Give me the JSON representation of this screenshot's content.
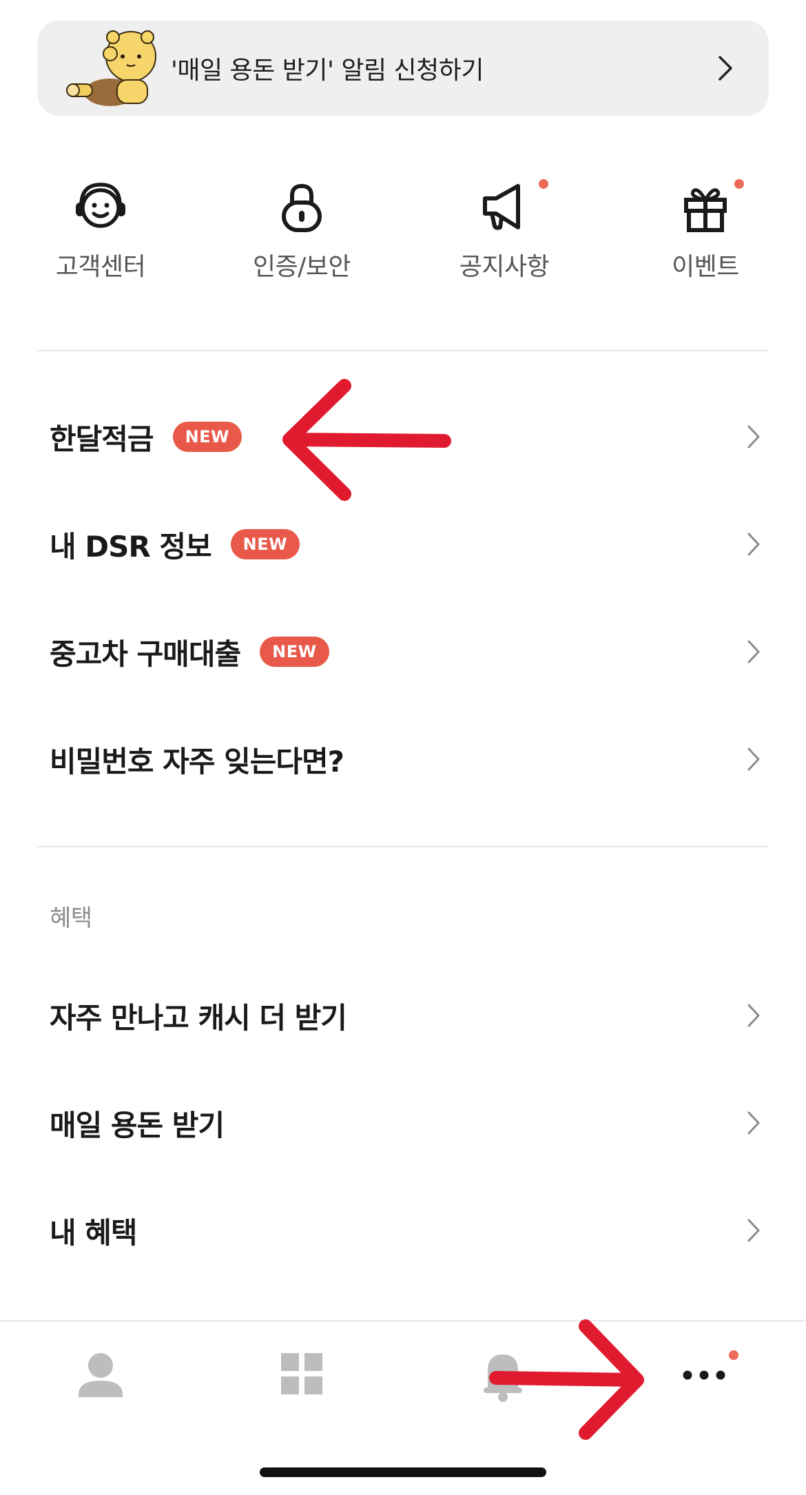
{
  "banner": {
    "text": "'매일 용돈 받기' 알림 신청하기",
    "icon": "chevron-right-icon"
  },
  "quick_menu": [
    {
      "label": "고객센터",
      "icon": "headset-smile-icon",
      "has_dot": false
    },
    {
      "label": "인증/보안",
      "icon": "lock-icon",
      "has_dot": false
    },
    {
      "label": "공지사항",
      "icon": "megaphone-icon",
      "has_dot": true
    },
    {
      "label": "이벤트",
      "icon": "gift-icon",
      "has_dot": true
    }
  ],
  "menu": [
    {
      "title": "한달적금",
      "badge": "NEW"
    },
    {
      "title": "내 DSR 정보",
      "badge": "NEW"
    },
    {
      "title": "중고차 구매대출",
      "badge": "NEW"
    },
    {
      "title": "비밀번호 자주 잊는다면?",
      "badge": ""
    }
  ],
  "benefits": {
    "section_label": "혜택",
    "items": [
      {
        "title": "자주 만나고 캐시 더 받기"
      },
      {
        "title": "매일 용돈 받기"
      },
      {
        "title": "내 혜택"
      }
    ]
  },
  "tabbar": {
    "tabs": [
      {
        "icon": "person-icon"
      },
      {
        "icon": "grid-icon"
      },
      {
        "icon": "bell-icon"
      },
      {
        "icon": "more-icon",
        "has_dot": true
      }
    ]
  },
  "colors": {
    "badge": "#e8594a",
    "notification_dot": "#ec6a5a",
    "annotation_arrow": "#e01b2f",
    "banner_bg": "#efefef"
  }
}
